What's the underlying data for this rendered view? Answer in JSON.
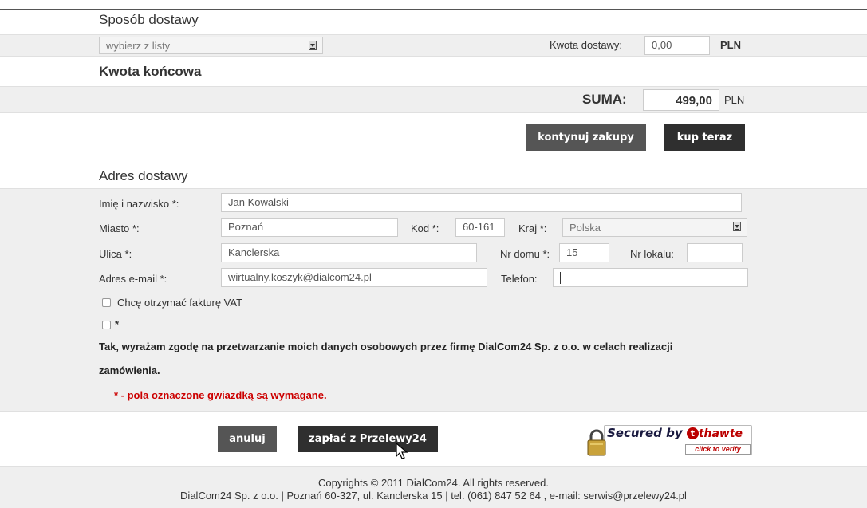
{
  "delivery": {
    "title": "Sposób dostawy",
    "select_value": "wybierz z listy",
    "amount_label": "Kwota dostawy:",
    "amount_value": "0,00",
    "currency": "PLN"
  },
  "total": {
    "title": "Kwota końcowa",
    "sum_label": "SUMA:",
    "sum_value": "499,00",
    "currency": "PLN"
  },
  "actions": {
    "continue_label": "kontynuj zakupy",
    "buy_label": "kup teraz"
  },
  "address": {
    "title": "Adres dostawy",
    "name_label": "Imię i nazwisko *:",
    "name_value": "Jan Kowalski",
    "city_label": "Miasto *:",
    "city_value": "Poznań",
    "zip_label": "Kod *:",
    "zip_value": "60-161",
    "country_label": "Kraj *:",
    "country_value": "Polska",
    "street_label": "Ulica *:",
    "street_value": "Kanclerska",
    "house_label": "Nr domu *:",
    "house_value": "15",
    "flat_label": "Nr lokalu:",
    "flat_value": "",
    "email_label": "Adres e-mail *:",
    "email_value": "wirtualny.koszyk@dialcom24.pl",
    "phone_label": "Telefon:",
    "phone_value": "",
    "vat_label": "Chcę otrzymać fakturę VAT",
    "consent_star": "*",
    "consent_line1": "Tak, wyrażam zgodę na przetwarzanie moich danych osobowych przez firmę DialCom24 Sp. z o.o. w celach realizacji",
    "consent_line2": "zamówienia.",
    "required_note": "* - pola oznaczone gwiazdką są wymagane."
  },
  "payment": {
    "cancel_label": "anuluj",
    "pay_label": "zapłać z Przelewy24"
  },
  "badge": {
    "secured_text": "Secured by",
    "brand": "thawte",
    "verify_text": "click to verify"
  },
  "footer": {
    "line1": "Copyrights © 2011 DialCom24. All rights reserved.",
    "line2": "DialCom24 Sp. z o.o. | Poznań 60-327, ul. Kanclerska 15 | tel. (061) 847 52 64 , e-mail: serwis@przelewy24.pl"
  },
  "colors": {
    "button": "#555555",
    "button_dark": "#2f2f2f",
    "required": "#cc0000",
    "band": "#efefef"
  }
}
